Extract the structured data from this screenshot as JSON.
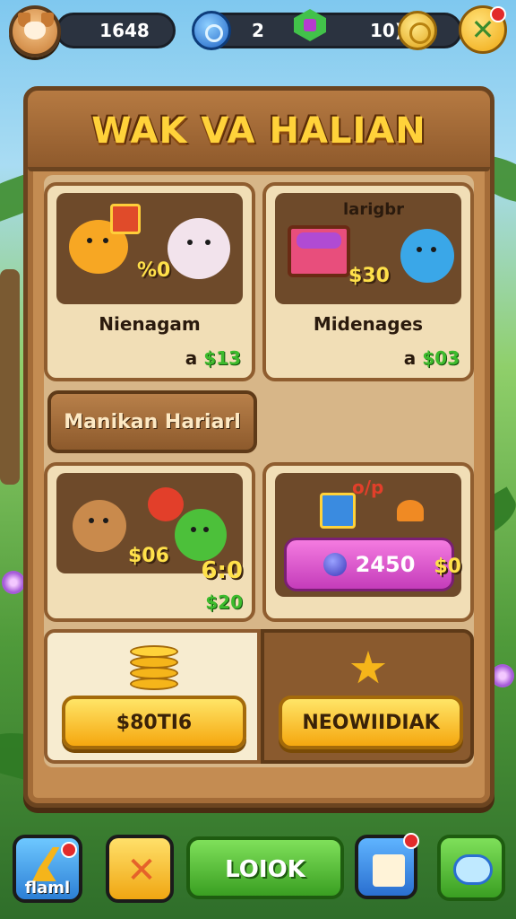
{
  "hud": {
    "coins_value": "1648",
    "energy_value": "2",
    "gold_value": "10)"
  },
  "panel": {
    "title": "WAK VA HALIAN",
    "section_button": "Manikan Hariarl"
  },
  "cards": [
    {
      "name": "Nienagam",
      "badge": "%0",
      "price_prefix": "a",
      "price": "$13"
    },
    {
      "name": "Midenages",
      "top_label": "larigbr",
      "badge": "$30",
      "price_prefix": "a",
      "price": "$03"
    },
    {
      "badge": "$06",
      "value_big": "6:0",
      "value_small": "$20"
    },
    {
      "top_label": "o/p",
      "pink_value": "2450",
      "side_value": "$0"
    }
  ],
  "purchase": {
    "left_button": "$80TI6",
    "right_button": "NEOWIIDIAK"
  },
  "nav": {
    "first_label": "flaml",
    "center_button": "LOIOK"
  },
  "colors": {
    "wood": "#c48c52",
    "title_gold": "#ffd23a",
    "pink_button": "#e45bd6",
    "gold_button": "#f9c52a",
    "green_button": "#4cbb2e"
  }
}
